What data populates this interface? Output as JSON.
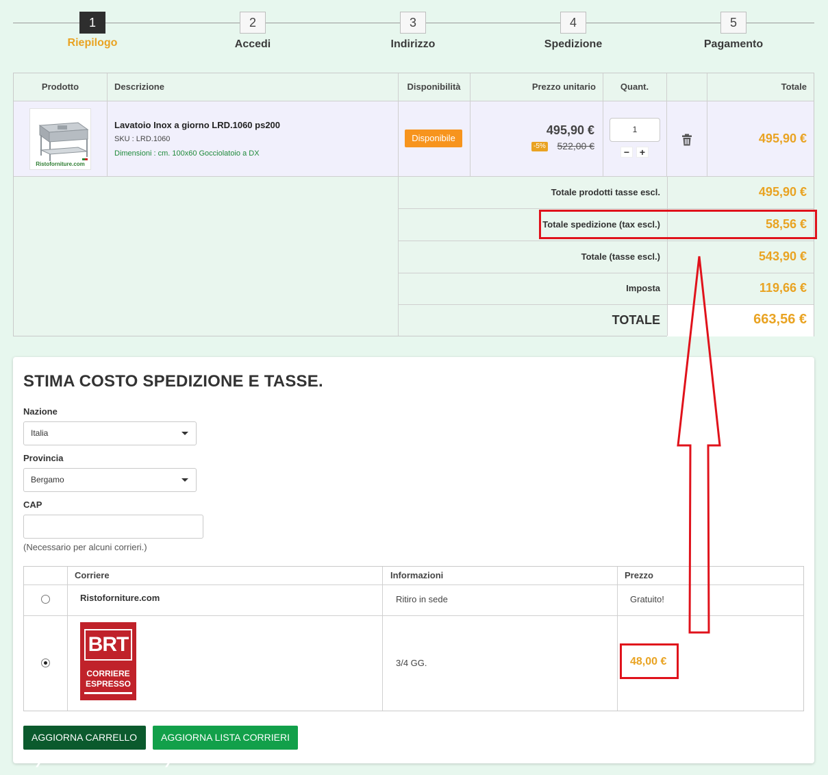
{
  "steps": [
    {
      "num": "1",
      "label": "Riepilogo"
    },
    {
      "num": "2",
      "label": "Accedi"
    },
    {
      "num": "3",
      "label": "Indirizzo"
    },
    {
      "num": "4",
      "label": "Spedizione"
    },
    {
      "num": "5",
      "label": "Pagamento"
    }
  ],
  "cart": {
    "headers": {
      "product": "Prodotto",
      "description": "Descrizione",
      "availability": "Disponibilità",
      "unit_price": "Prezzo unitario",
      "quantity": "Quant.",
      "total": "Totale"
    },
    "item": {
      "image_text": "Ristoforniture.com",
      "name": "Lavatoio Inox a giorno LRD.1060 ps200",
      "sku": "SKU : LRD.1060",
      "dimensions": "Dimensioni : cm. 100x60 Gocciolatoio a DX",
      "availability": "Disponibile",
      "price": "495,90 €",
      "discount": "-5%",
      "old_price": "522,00 €",
      "quantity": "1",
      "qty_minus": "−",
      "qty_plus": "+",
      "line_total": "495,90 €"
    },
    "summary": {
      "products_label": "Totale prodotti tasse escl.",
      "products_value": "495,90 €",
      "shipping_label": "Totale spedizione (tax escl.)",
      "shipping_value": "58,56 €",
      "subtotal_label": "Totale (tasse escl.)",
      "subtotal_value": "543,90 €",
      "tax_label": "Imposta",
      "tax_value": "119,66 €",
      "total_label": "TOTALE",
      "total_value": "663,56 €"
    }
  },
  "estimate": {
    "title": "STIMA COSTO SPEDIZIONE E TASSE.",
    "country_label": "Nazione",
    "country_value": "Italia",
    "province_label": "Provincia",
    "province_value": "Bergamo",
    "zip_label": "CAP",
    "zip_value": "",
    "zip_hint": "(Necessario per alcuni corrieri.)",
    "carriers_headers": {
      "carrier": "Corriere",
      "info": "Informazioni",
      "price": "Prezzo"
    },
    "carriers": [
      {
        "name": "Ristoforniture.com",
        "info": "Ritiro in sede",
        "price": "Gratuito!",
        "selected": false
      },
      {
        "logo_text_main": "BRT",
        "logo_text_sub1": "CORRIERE",
        "logo_text_sub2": "ESPRESSO",
        "info": "3/4 GG.",
        "price": "48,00 €",
        "selected": true
      }
    ],
    "buttons": {
      "update_cart": "AGGIORNA CARRELLO",
      "update_carriers": "AGGIORNA LISTA CORRIERI"
    }
  },
  "colors": {
    "accent": "#e9a322",
    "annotation": "#e0121b",
    "available": "#f7941d",
    "button_dark": "#0b5a2d",
    "button_green": "#12a04a"
  }
}
